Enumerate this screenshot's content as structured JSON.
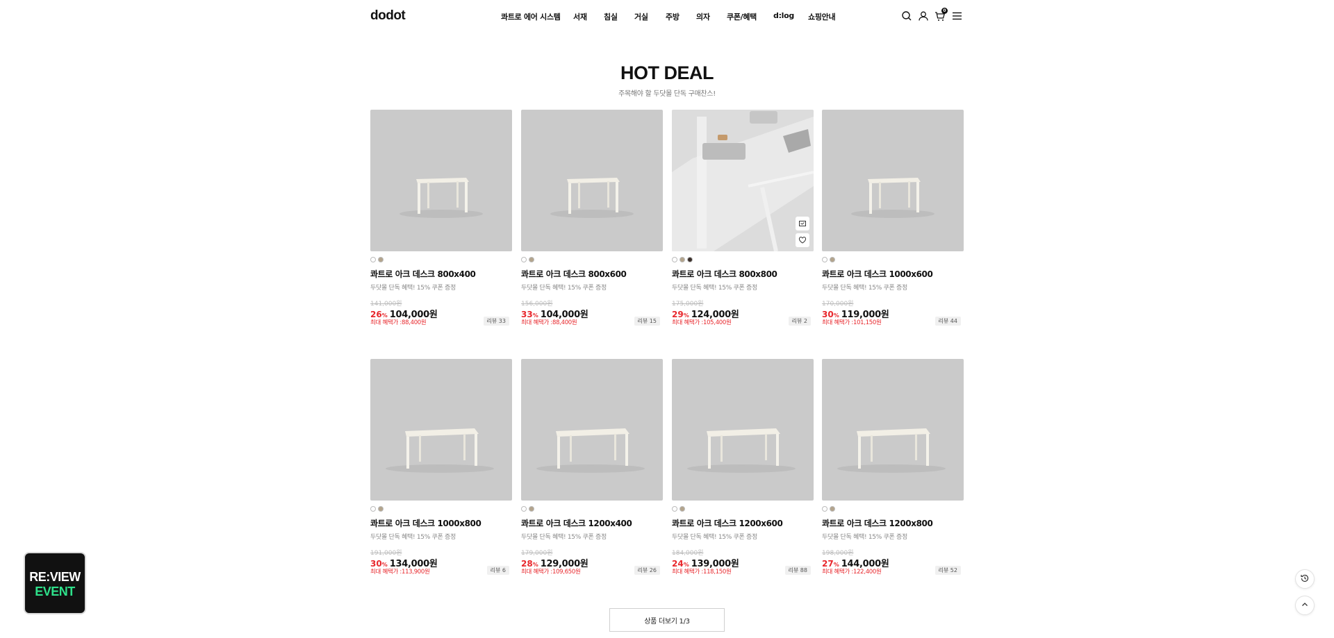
{
  "brand": {
    "logo": "dodot"
  },
  "nav": {
    "items": [
      {
        "label": "콰트로 에어 시스템"
      },
      {
        "label": "서재"
      },
      {
        "label": "침실"
      },
      {
        "label": "거실"
      },
      {
        "label": "주방"
      },
      {
        "label": "의자"
      },
      {
        "label": "쿠폰/혜택"
      },
      {
        "label": "d:log"
      },
      {
        "label": "쇼핑안내"
      }
    ]
  },
  "header_icons": {
    "search": "search-icon",
    "account": "user-icon",
    "cart": "cart-icon",
    "cart_count": "0",
    "menu": "hamburger-menu-icon"
  },
  "section": {
    "title": "HOT DEAL",
    "subtitle": "주목해야 할 두닷몰 단독 구매찬스!"
  },
  "colors": {
    "accent_red": "#e8272c",
    "thumb_bg": "#cacaca",
    "swatch_white": "#ffffff",
    "swatch_beige": "#b3a48c",
    "swatch_dark": "#3b2f2a",
    "review_green": "#2ee08a"
  },
  "products": [
    {
      "name": "콰트로 아크 데스크 800x400",
      "desc": "두닷몰 단독 혜택! 15% 쿠폰 증정",
      "original_price": "141,000원",
      "discount": "26",
      "discount_unit": "%",
      "price": "104,000원",
      "benefit": "최대 혜택가 :88,400원",
      "reviews": "리뷰 33",
      "swatches": [
        "#ffffff",
        "#b3a48c"
      ]
    },
    {
      "name": "콰트로 아크 데스크 800x600",
      "desc": "두닷몰 단독 혜택! 15% 쿠폰 증정",
      "original_price": "156,000원",
      "discount": "33",
      "discount_unit": "%",
      "price": "104,000원",
      "benefit": "최대 혜택가 :88,400원",
      "reviews": "리뷰 15",
      "swatches": [
        "#ffffff",
        "#b3a48c"
      ]
    },
    {
      "name": "콰트로 아크 데스크 800x800",
      "desc": "두닷몰 단독 혜택! 15% 쿠폰 증정",
      "original_price": "175,000원",
      "discount": "29",
      "discount_unit": "%",
      "price": "124,000원",
      "benefit": "최대 혜택가 :105,400원",
      "reviews": "리뷰 2",
      "swatches": [
        "#ffffff",
        "#b3a48c",
        "#3b2f2a"
      ]
    },
    {
      "name": "콰트로 아크 데스크 1000x600",
      "desc": "두닷몰 단독 혜택! 15% 쿠폰 증정",
      "original_price": "170,000원",
      "discount": "30",
      "discount_unit": "%",
      "price": "119,000원",
      "benefit": "최대 혜택가 :101,150원",
      "reviews": "리뷰 44",
      "swatches": [
        "#ffffff",
        "#b3a48c"
      ]
    },
    {
      "name": "콰트로 아크 데스크 1000x800",
      "desc": "두닷몰 단독 혜택! 15% 쿠폰 증정",
      "original_price": "191,000원",
      "discount": "30",
      "discount_unit": "%",
      "price": "134,000원",
      "benefit": "최대 혜택가 :113,900원",
      "reviews": "리뷰 6",
      "swatches": [
        "#ffffff",
        "#b3a48c"
      ]
    },
    {
      "name": "콰트로 아크 데스크 1200x400",
      "desc": "두닷몰 단독 혜택! 15% 쿠폰 증정",
      "original_price": "179,000원",
      "discount": "28",
      "discount_unit": "%",
      "price": "129,000원",
      "benefit": "최대 혜택가 :109,650원",
      "reviews": "리뷰 26",
      "swatches": [
        "#ffffff",
        "#b3a48c"
      ]
    },
    {
      "name": "콰트로 아크 데스크 1200x600",
      "desc": "두닷몰 단독 혜택! 15% 쿠폰 증정",
      "original_price": "184,000원",
      "discount": "24",
      "discount_unit": "%",
      "price": "139,000원",
      "benefit": "최대 혜택가 :118,150원",
      "reviews": "리뷰 88",
      "swatches": [
        "#ffffff",
        "#b3a48c"
      ]
    },
    {
      "name": "콰트로 아크 데스크 1200x800",
      "desc": "두닷몰 단독 혜택! 15% 쿠폰 증정",
      "original_price": "198,000원",
      "discount": "27",
      "discount_unit": "%",
      "price": "144,000원",
      "benefit": "최대 혜택가 :122,400원",
      "reviews": "리뷰 52",
      "swatches": [
        "#ffffff",
        "#b3a48c"
      ]
    }
  ],
  "more_button": {
    "label": "상품 더보기 1/3"
  },
  "review_event": {
    "line1": "RE:VIEW",
    "line2": "EVENT"
  },
  "floating": {
    "recent": "history-icon",
    "top": "arrow-up-icon"
  }
}
